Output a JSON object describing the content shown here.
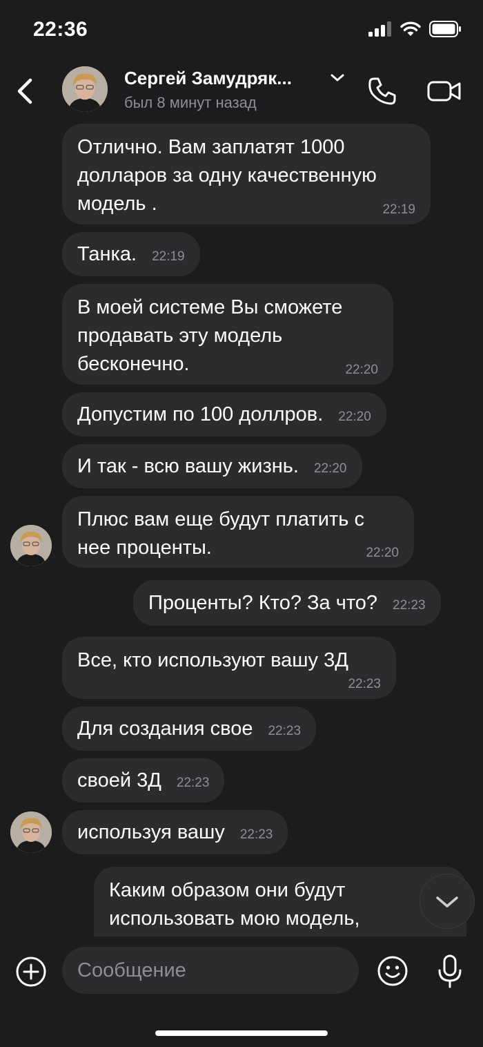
{
  "status_bar": {
    "time": "22:36"
  },
  "header": {
    "contact_name": "Сергей Замудряк...",
    "last_seen": "был 8 минут назад"
  },
  "messages": [
    {
      "text": "Отлично. Вам заплатят 1000\nдолларов за одну качественную\nмодель .",
      "time": "22:19",
      "direction": "incoming"
    },
    {
      "text": "Танка.",
      "time": "22:19",
      "direction": "incoming"
    },
    {
      "text": "В моей системе Вы сможете\nпродавать эту модель\nбесконечно.",
      "time": "22:20",
      "direction": "incoming"
    },
    {
      "text": "Допустим по 100 доллров.",
      "time": "22:20",
      "direction": "incoming"
    },
    {
      "text": "И так - всю вашу жизнь.",
      "time": "22:20",
      "direction": "incoming"
    },
    {
      "text": "Плюс вам еще будут платить с\nнее проценты.",
      "time": "22:20",
      "direction": "incoming"
    },
    {
      "text": "Проценты? Кто? За что?",
      "time": "22:23",
      "direction": "outgoing"
    },
    {
      "text": "Все, кто используют вашу 3Д",
      "time": "22:23",
      "direction": "incoming"
    },
    {
      "text": "Для создания свое",
      "time": "22:23",
      "direction": "incoming"
    },
    {
      "text": "своей 3Д",
      "time": "22:23",
      "direction": "incoming"
    },
    {
      "text": "используя вашу",
      "time": "22:23",
      "direction": "incoming"
    },
    {
      "text": "Каким образом они будут\nиспользовать мою модель,",
      "time": "",
      "direction": "outgoing"
    }
  ],
  "composer": {
    "placeholder": "Сообщение"
  },
  "colors": {
    "background": "#1c1c1e",
    "bubble": "#2c2c2e",
    "secondary_text": "#8e8e93"
  }
}
